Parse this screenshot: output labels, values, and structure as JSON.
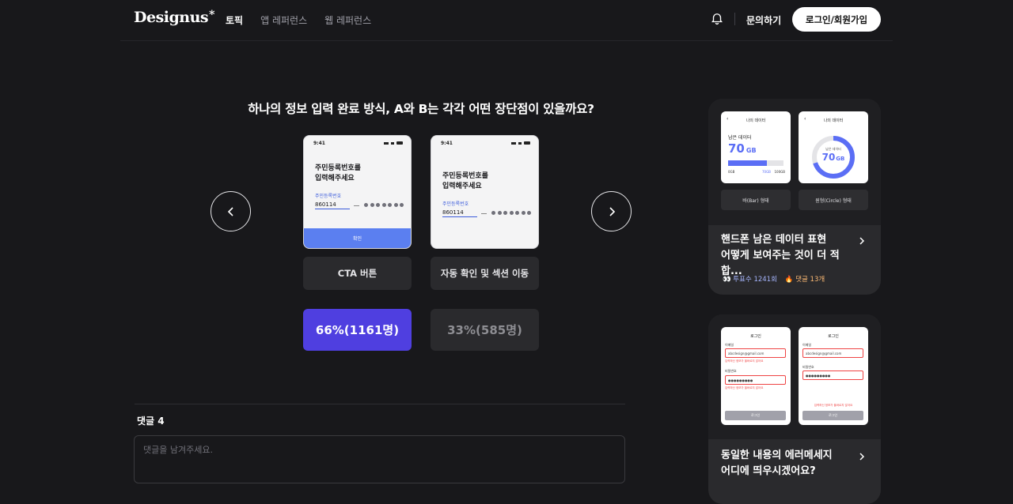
{
  "header": {
    "logo": "Designus",
    "logo_mark": "*",
    "nav": [
      "토픽",
      "앱 레퍼런스",
      "웹 레퍼런스"
    ],
    "active_nav": 0,
    "contact": "문의하기",
    "login": "로그인/회원가입"
  },
  "topic": {
    "question": "하나의 정보 입력 완료 방식, A와 B는 각각 어떤 장단점이 있을까요?",
    "options": [
      {
        "phone": {
          "time": "9:41",
          "title_line1": "주민등록번호를",
          "title_line2": "입력해주세요",
          "field_label": "주민등록번호",
          "field_value": "860114",
          "cta": "확인"
        },
        "label": "CTA 버튼",
        "result": "66%(1161명)",
        "percent": 66
      },
      {
        "phone": {
          "time": "9:41",
          "title_line1": "주민등록번호를",
          "title_line2": "입력해주세요",
          "field_label": "주민등록번호",
          "field_value": "860114"
        },
        "label": "자동 확인 및 섹션 이동",
        "result": "33%(585명)",
        "percent": 33
      }
    ]
  },
  "comments": {
    "title": "댓글 4",
    "placeholder": "댓글을 남겨주세요."
  },
  "cards": [
    {
      "mini_a": {
        "title": "나의 데이터",
        "label": "남은 데이터",
        "value": "70",
        "unit": "GB",
        "scale_min": "0GB",
        "scale_mid": "70GB",
        "scale_max": "100GB"
      },
      "mini_b": {
        "title": "나의 데이터",
        "label": "남은 데이터",
        "value": "70",
        "unit": "GB"
      },
      "label_a": "바(Bar) 형태",
      "label_b": "원형(Circle) 형태",
      "title_line1": "핸드폰 남은 데이터 표현",
      "title_line2": "어떻게 보여주는 것이 더 적합...",
      "votes": "투표수 1241회",
      "comments": "댓글 13개",
      "accent": "#5b6ef5"
    },
    {
      "mini_a": {
        "title": "로그인",
        "email_label": "이메일",
        "email_value": "abcdesign@gmail.com",
        "email_error": "입력하신 정보가 올바르지 않아요",
        "pw_label": "비밀번호",
        "pw_value": "●●●●●●●●●",
        "pw_error": "입력하신 정보가 올바르지 않아요",
        "button": "로그인"
      },
      "mini_b": {
        "title": "로그인",
        "email_label": "이메일",
        "email_value": "abcdesign@gmail.com",
        "pw_label": "비밀번호",
        "pw_value": "●●●●●●●●●",
        "error": "입력하신 정보가 올바르지 않아요",
        "button": "로그인"
      },
      "title_line1": "동일한 내용의 에러메세지",
      "title_line2": "어디에 띄우시겠어요?"
    }
  ]
}
